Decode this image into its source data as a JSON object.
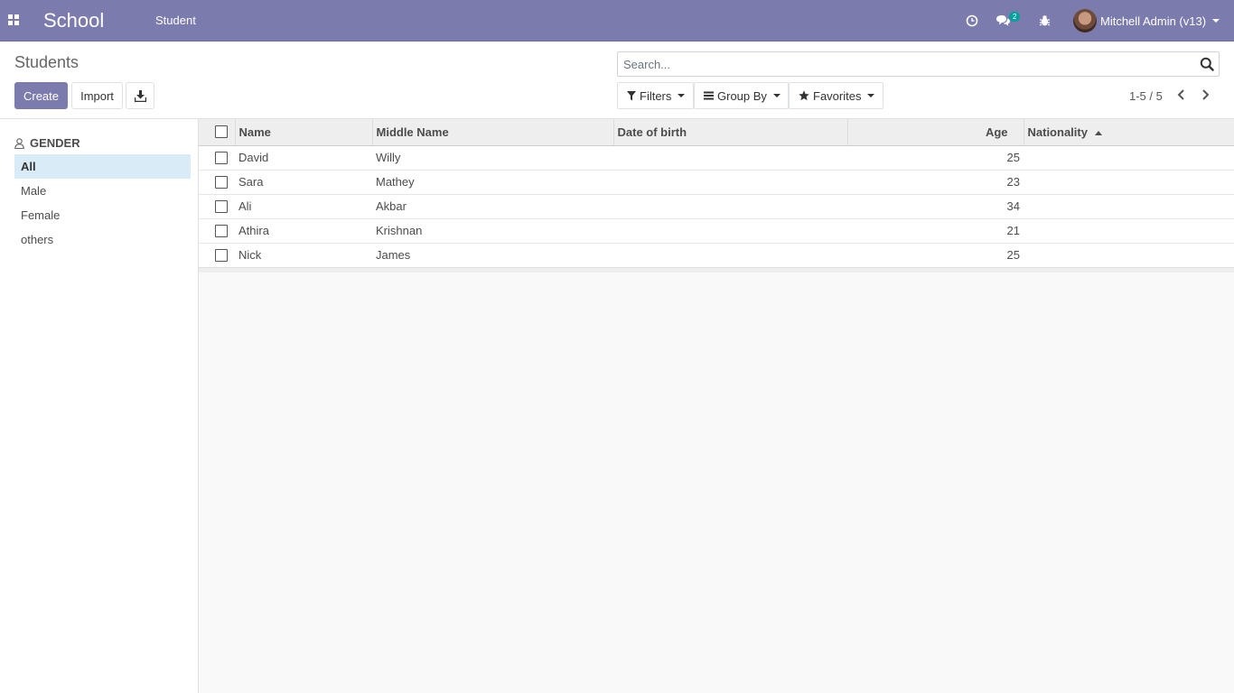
{
  "navbar": {
    "app_title": "School",
    "menu_item": "Student",
    "messages_count": "2",
    "user_name": "Mitchell Admin (v13)"
  },
  "control_panel": {
    "breadcrumb": "Students",
    "create_label": "Create",
    "import_label": "Import",
    "search_placeholder": "Search...",
    "filters_label": "Filters",
    "groupby_label": "Group By",
    "favorites_label": "Favorites",
    "pager": "1-5 / 5"
  },
  "sidebar": {
    "header": "GENDER",
    "items": [
      {
        "label": "All",
        "active": true
      },
      {
        "label": "Male"
      },
      {
        "label": "Female"
      },
      {
        "label": "others"
      }
    ]
  },
  "table": {
    "columns": [
      "Name",
      "Middle Name",
      "Date of birth",
      "Age",
      "Nationality"
    ],
    "rows": [
      {
        "name": "David",
        "middle_name": "Willy",
        "dob": "",
        "age": "25",
        "nationality": ""
      },
      {
        "name": "Sara",
        "middle_name": "Mathey",
        "dob": "",
        "age": "23",
        "nationality": ""
      },
      {
        "name": "Ali",
        "middle_name": "Akbar",
        "dob": "",
        "age": "34",
        "nationality": ""
      },
      {
        "name": "Athira",
        "middle_name": "Krishnan",
        "dob": "",
        "age": "21",
        "nationality": ""
      },
      {
        "name": "Nick",
        "middle_name": "James",
        "dob": "",
        "age": "25",
        "nationality": ""
      }
    ]
  },
  "colors": {
    "brand": "#7c7bad",
    "active_filter_bg": "#d8ebf7"
  }
}
